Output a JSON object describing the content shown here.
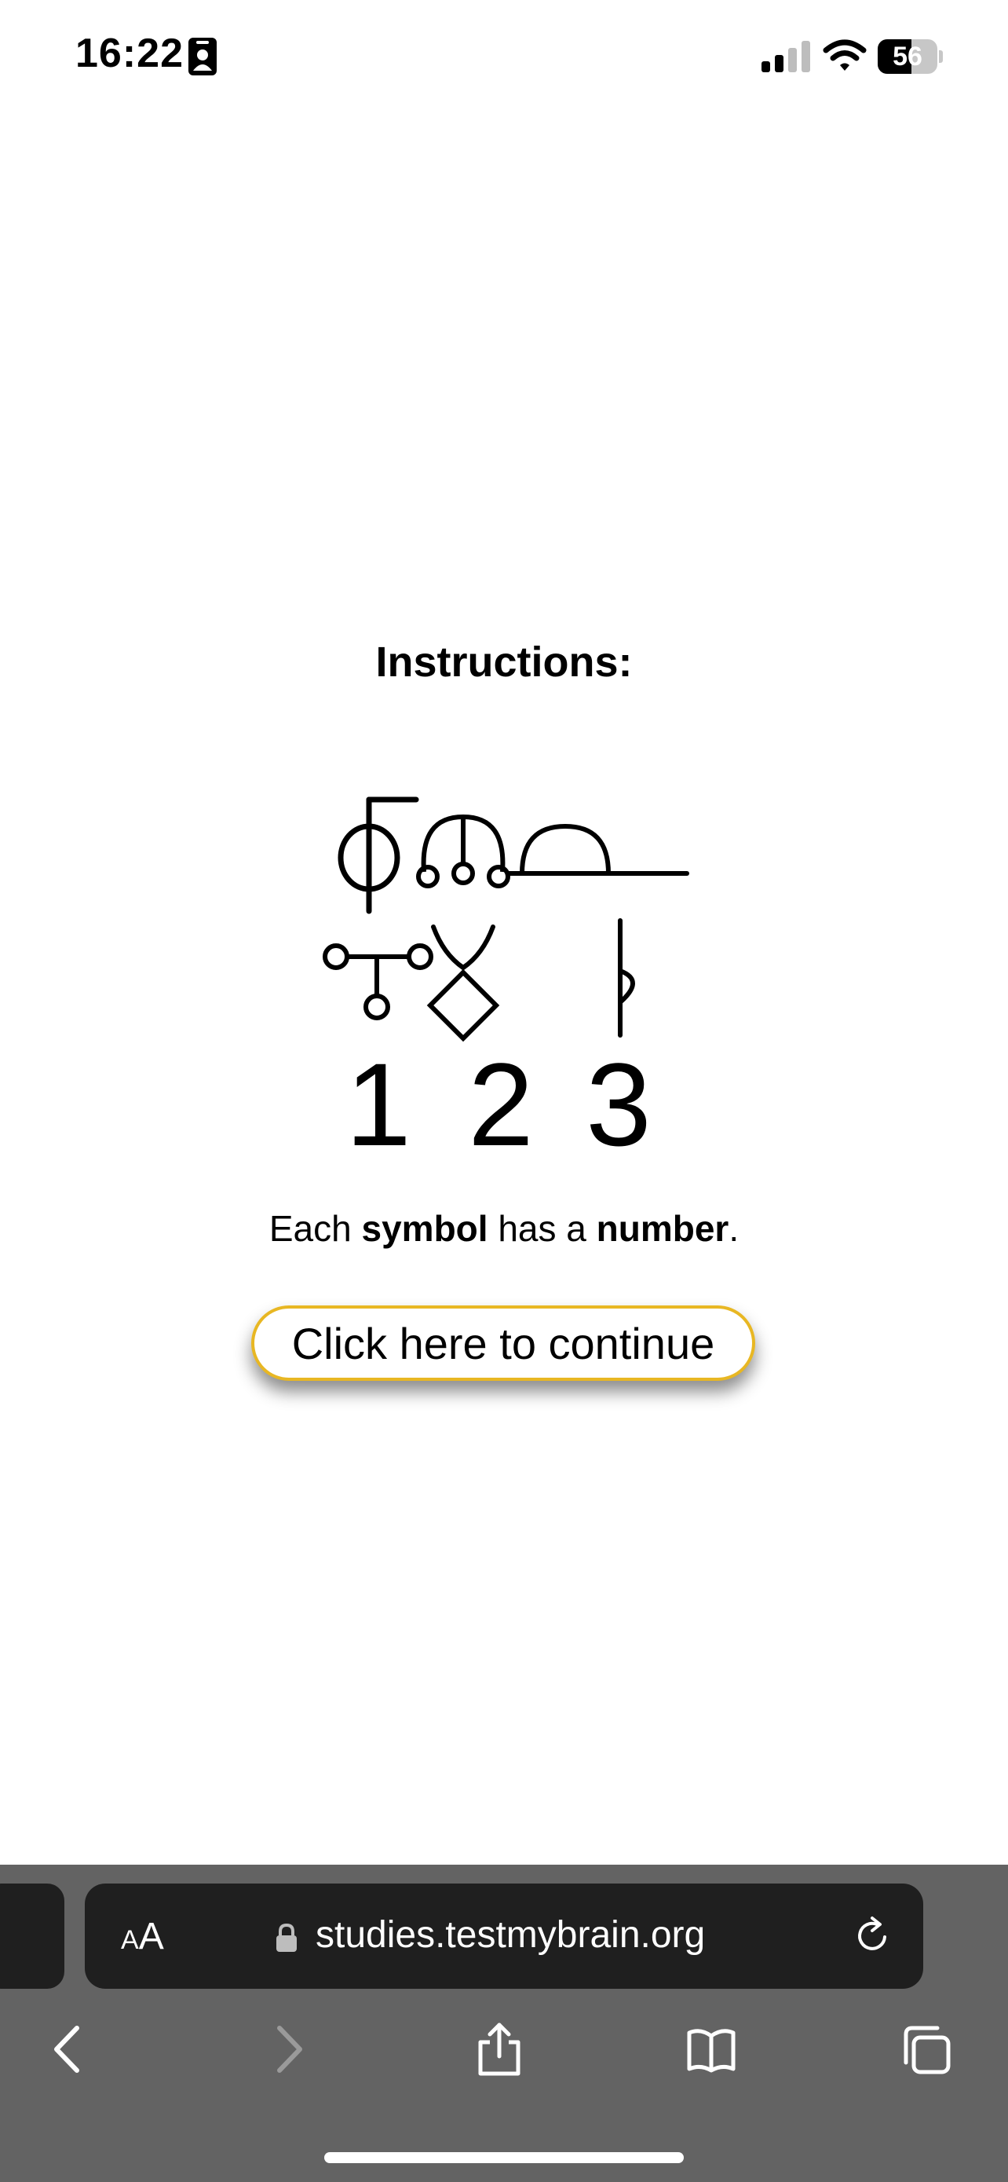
{
  "status_bar": {
    "time": "16:22",
    "battery_level": "56",
    "battery_fraction": 0.56
  },
  "page": {
    "title": "Instructions:",
    "numbers": [
      "1",
      "2",
      "3"
    ],
    "instruction": {
      "part1": "Each ",
      "bold1": "symbol",
      "part2": " has a ",
      "bold2": "number",
      "part3": "."
    },
    "continue_label": "Click here to continue"
  },
  "browser": {
    "text_size_label_small": "A",
    "text_size_label_large": "A",
    "url": "studies.testmybrain.org"
  },
  "icons": {
    "id": "id-card-icon",
    "signal": "cellular-signal-icon",
    "wifi": "wifi-icon",
    "lock": "lock-icon",
    "reload": "reload-icon",
    "back": "chevron-left-icon",
    "forward": "chevron-right-icon",
    "share": "share-icon",
    "bookmarks": "book-icon",
    "tabs": "tabs-icon"
  },
  "colors": {
    "button_border": "#e8b723",
    "chrome_bg": "#636363",
    "address_bar_bg": "#1f1f1f"
  }
}
